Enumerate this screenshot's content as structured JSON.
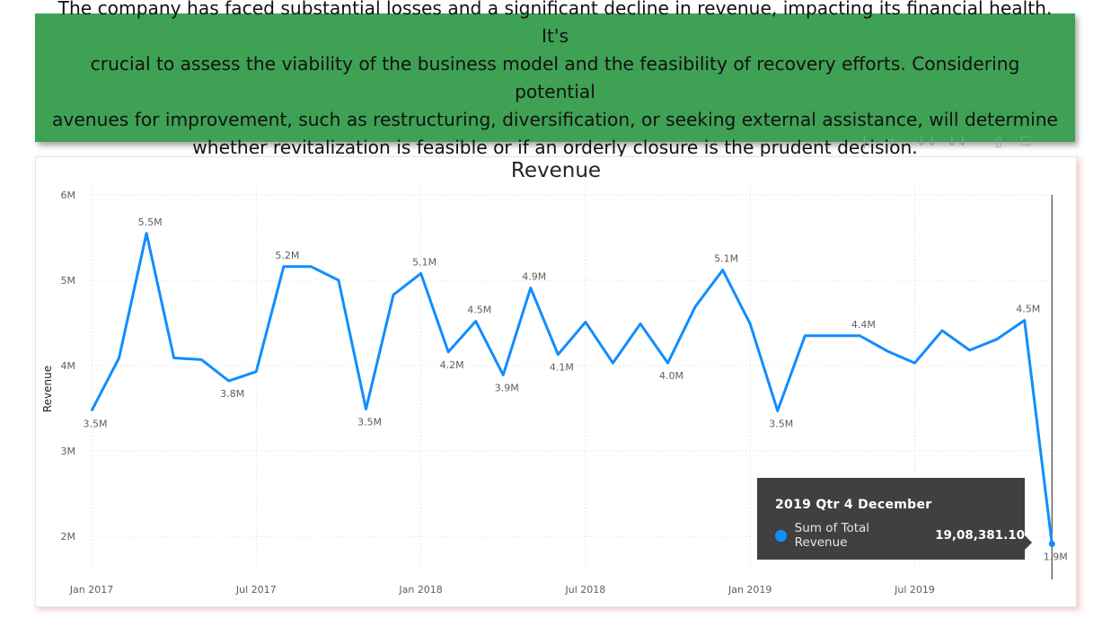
{
  "banner": {
    "lines": [
      "The company has faced substantial losses and a significant decline in revenue, impacting its financial health. It's",
      "crucial to assess the viability of the business model and the feasibility of recovery efforts. Considering potential",
      "avenues for improvement, such as restructuring, diversification, or seeking external assistance, will determine",
      "whether revitalization is feasible or if an orderly closure is the prudent decision."
    ]
  },
  "toolbar": {
    "icons": [
      "pin-icon",
      "drill-down-icon",
      "drill-next-level-icon",
      "expand-hierarchy-icon",
      "filter-icon",
      "focus-mode-icon"
    ],
    "color": "#9a9a9a"
  },
  "chart_data": {
    "type": "line",
    "title": "Revenue",
    "ylabel": "Revenue",
    "xlabel": "",
    "ylim": [
      1.5,
      6.0
    ],
    "yticks": [
      2,
      3,
      4,
      5,
      6
    ],
    "ytick_labels": [
      "2M",
      "3M",
      "4M",
      "5M",
      "6M"
    ],
    "xtick_labels": [
      "Jan 2017",
      "Jul 2017",
      "Jan 2018",
      "Jul 2018",
      "Jan 2019",
      "Jul 2019"
    ],
    "xtick_indices": [
      0,
      6,
      12,
      18,
      24,
      30
    ],
    "grid": true,
    "line_color": "#118dff",
    "series": [
      {
        "values": [
          3.47,
          4.09,
          5.55,
          4.09,
          4.07,
          3.82,
          3.93,
          5.16,
          5.16,
          5.0,
          3.49,
          4.83,
          5.08,
          4.16,
          4.52,
          3.89,
          4.91,
          4.13,
          4.51,
          4.03,
          4.49,
          4.03,
          4.69,
          5.12,
          4.49,
          3.47,
          4.35,
          4.35,
          4.35,
          4.17,
          4.03,
          4.41,
          4.18,
          4.31,
          4.53,
          1.91
        ]
      }
    ],
    "data_labels": [
      {
        "index": 0,
        "text": "3.5M",
        "pos": "below"
      },
      {
        "index": 2,
        "text": "5.5M",
        "pos": "above"
      },
      {
        "index": 5,
        "text": "3.8M",
        "pos": "below"
      },
      {
        "index": 7,
        "text": "5.2M",
        "pos": "above"
      },
      {
        "index": 10,
        "text": "3.5M",
        "pos": "below"
      },
      {
        "index": 12,
        "text": "5.1M",
        "pos": "above"
      },
      {
        "index": 13,
        "text": "4.2M",
        "pos": "below"
      },
      {
        "index": 14,
        "text": "4.5M",
        "pos": "above"
      },
      {
        "index": 15,
        "text": "3.9M",
        "pos": "below"
      },
      {
        "index": 16,
        "text": "4.9M",
        "pos": "above"
      },
      {
        "index": 17,
        "text": "4.1M",
        "pos": "below"
      },
      {
        "index": 21,
        "text": "4.0M",
        "pos": "below"
      },
      {
        "index": 23,
        "text": "5.1M",
        "pos": "above"
      },
      {
        "index": 25,
        "text": "3.5M",
        "pos": "below"
      },
      {
        "index": 28,
        "text": "4.4M",
        "pos": "above"
      },
      {
        "index": 34,
        "text": "4.5M",
        "pos": "above"
      },
      {
        "index": 35,
        "text": "1.9M",
        "pos": "below"
      }
    ],
    "highlight_index": 35
  },
  "tooltip": {
    "title": "2019 Qtr 4 December",
    "series_label": "Sum of Total Revenue",
    "value": "19,08,381.10",
    "dot_color": "#118dff"
  }
}
